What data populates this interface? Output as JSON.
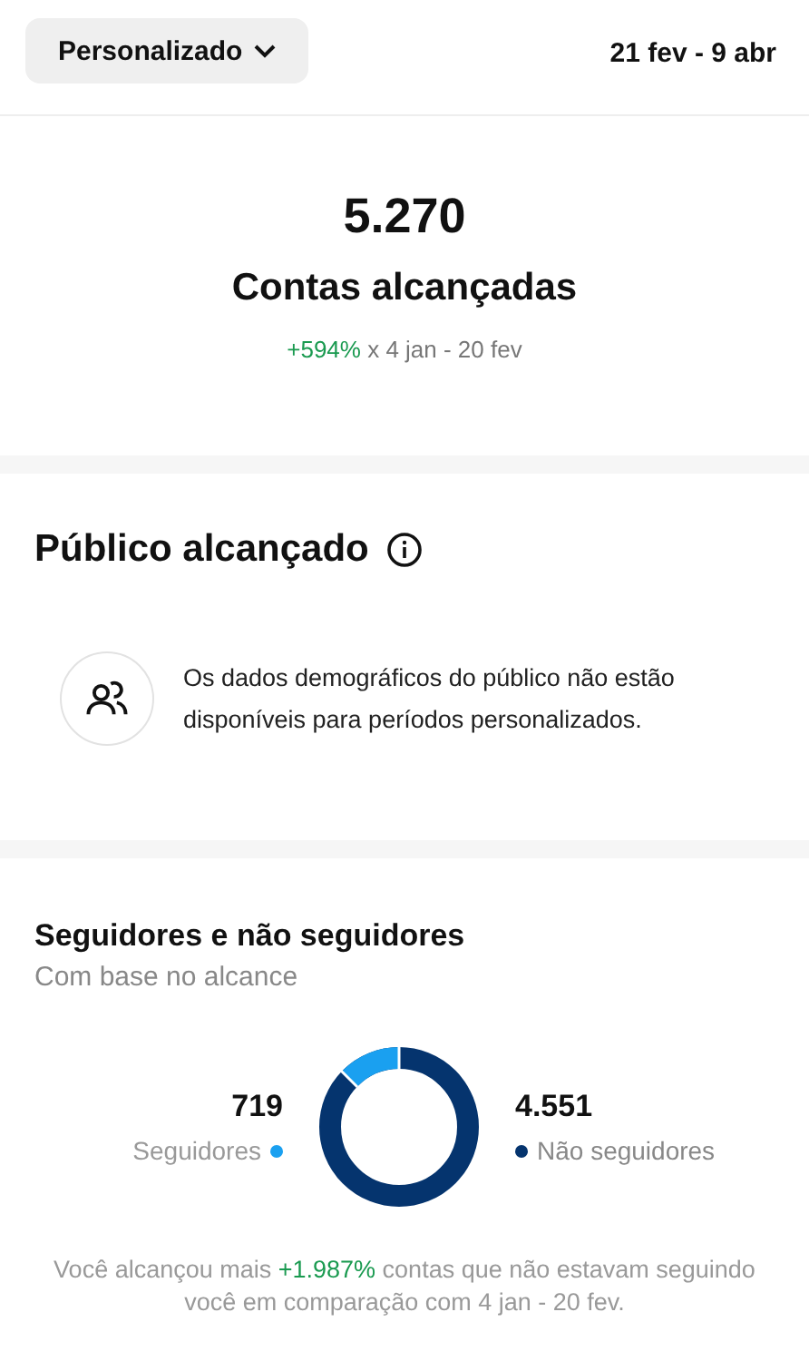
{
  "header": {
    "period_button": "Personalizado",
    "date_range": "21 fev - 9 abr"
  },
  "summary": {
    "value": "5.270",
    "label": "Contas alcançadas",
    "change": "+594%",
    "comparison": "x 4 jan - 20 fev"
  },
  "audience": {
    "title": "Público alcançado",
    "message": "Os dados demográficos do público não estão disponíveis para períodos personalizados."
  },
  "followers": {
    "title": "Seguidores e não seguidores",
    "subtitle": "Com base no alcance",
    "legend": [
      {
        "value": "719",
        "label": "Seguidores",
        "color": "#1aa0f0"
      },
      {
        "value": "4.551",
        "label": "Não seguidores",
        "color": "#05346e"
      }
    ],
    "note_before": "Você alcançou mais",
    "note_highlight": "+1.987%",
    "note_after": "contas que não estavam seguindo você em comparação com 4 jan - 20 fev."
  }
}
